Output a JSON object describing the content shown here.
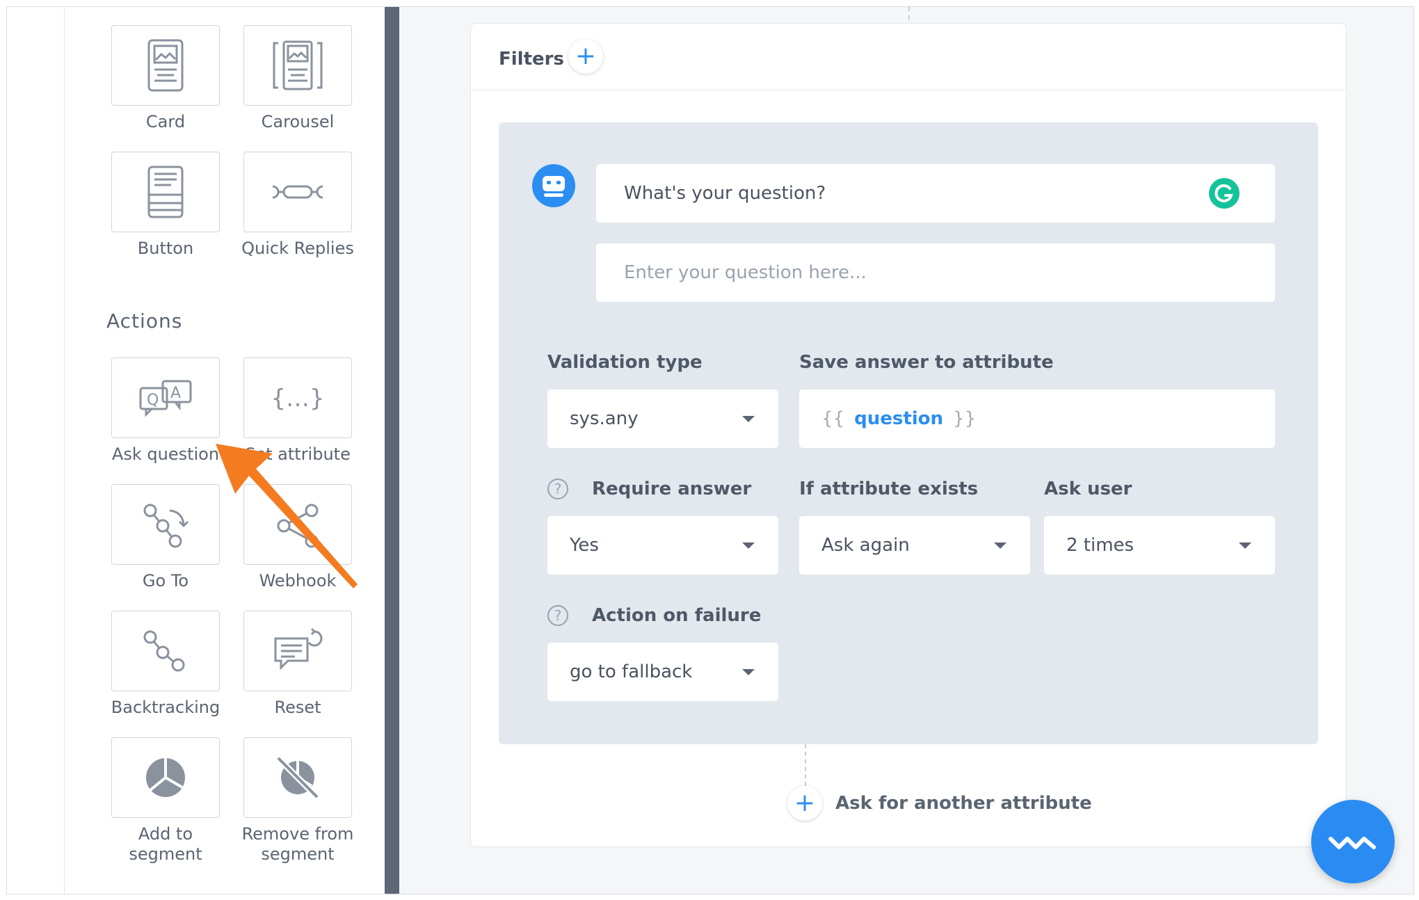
{
  "sidebar": {
    "tiles": [
      {
        "label": "Card",
        "icon": "card-icon"
      },
      {
        "label": "Carousel",
        "icon": "carousel-icon"
      },
      {
        "label": "Button",
        "icon": "button-icon"
      },
      {
        "label": "Quick Replies",
        "icon": "quick-replies-icon"
      }
    ],
    "actions_title": "Actions",
    "actions": [
      {
        "label": "Ask question",
        "icon": "ask-question-icon"
      },
      {
        "label": "Set attribute",
        "icon": "set-attribute-icon"
      },
      {
        "label": "Go To",
        "icon": "go-to-icon"
      },
      {
        "label": "Webhook",
        "icon": "webhook-icon"
      },
      {
        "label": "Backtracking",
        "icon": "backtracking-icon"
      },
      {
        "label": "Reset",
        "icon": "reset-icon"
      },
      {
        "label": "Add to\nsegment",
        "label_lines": [
          "Add to",
          "segment"
        ],
        "icon": "add-to-segment-icon"
      },
      {
        "label": "Remove from\nsegment",
        "label_lines": [
          "Remove from",
          "segment"
        ],
        "icon": "remove-from-segment-icon"
      }
    ]
  },
  "main": {
    "filters_label": "Filters",
    "question_value": "What's your question?",
    "question_placeholder": "Enter your question here...",
    "validation_type_label": "Validation type",
    "validation_type_value": "sys.any",
    "save_answer_label": "Save answer to attribute",
    "attr_open": "{{",
    "attr_name": "question",
    "attr_close": "}}",
    "require_answer_label": "Require answer",
    "require_answer_value": "Yes",
    "if_exists_label": "If attribute exists",
    "if_exists_value": "Ask again",
    "ask_user_label": "Ask user",
    "ask_user_value": "2 times",
    "action_failure_label": "Action on failure",
    "action_failure_value": "go to fallback",
    "ask_another_label": "Ask for another attribute",
    "help_glyph": "?"
  },
  "colors": {
    "accent": "#2b8ef0",
    "arrow": "#f47b20",
    "sidebar_bar": "#5d6775",
    "grammarly": "#15c39a"
  }
}
